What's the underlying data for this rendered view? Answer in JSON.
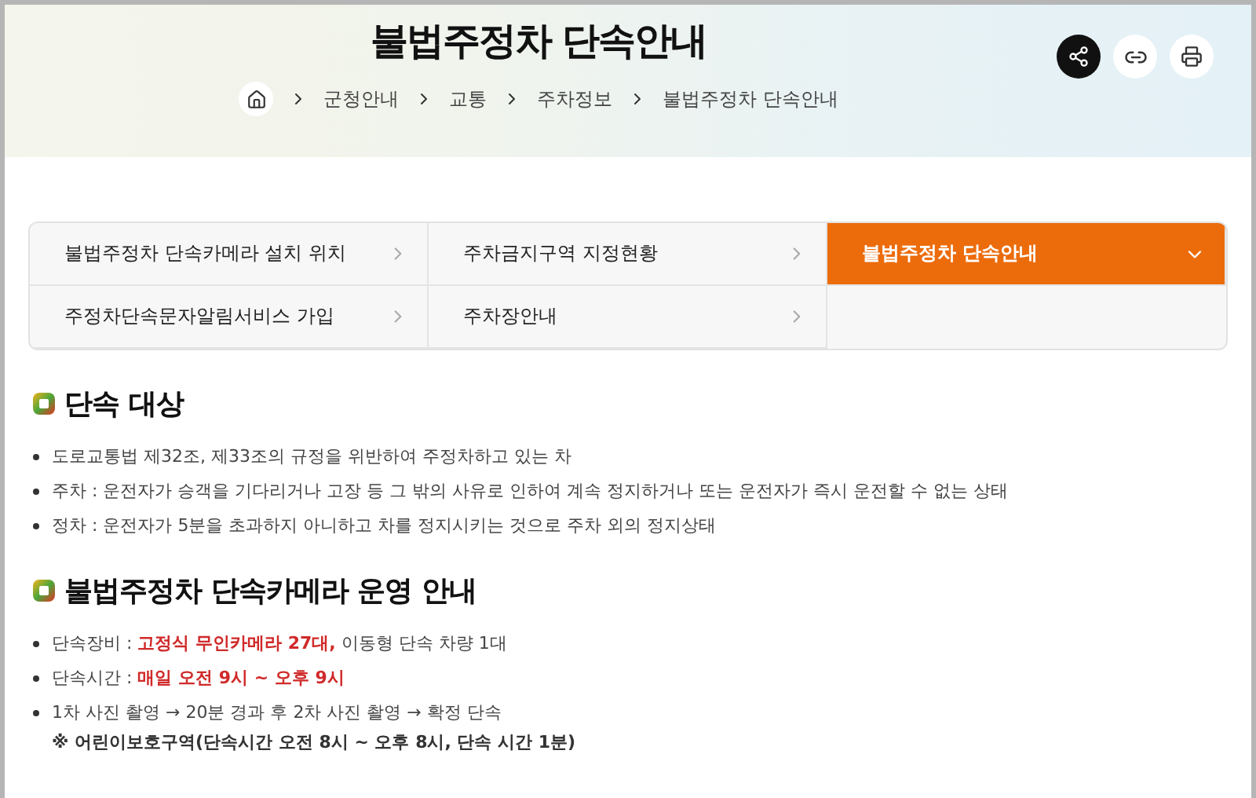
{
  "header": {
    "title": "불법주정차 단속안내",
    "breadcrumb": [
      "군청안내",
      "교통",
      "주차정보",
      "불법주정차 단속안내"
    ]
  },
  "tabs": [
    {
      "label": "불법주정차 단속카메라 설치 위치",
      "selected": false
    },
    {
      "label": "주차금지구역 지정현황",
      "selected": false
    },
    {
      "label": "불법주정차 단속안내",
      "selected": true
    },
    {
      "label": "주정차단속문자알림서비스 가입",
      "selected": false
    },
    {
      "label": "주차장안내",
      "selected": false
    }
  ],
  "sections": [
    {
      "heading": "단속 대상",
      "items": [
        {
          "text": "도로교통법 제32조, 제33조의 규정을 위반하여 주정차하고 있는 차"
        },
        {
          "text": "주차 : 운전자가 승객을 기다리거나 고장 등 그 밖의 사유로 인하여 계속 정지하거나 또는 운전자가 즉시 운전할 수 없는 상태"
        },
        {
          "text": "정차 : 운전자가 5분을 초과하지 아니하고 차를 정지시키는 것으로 주차 외의 정지상태"
        }
      ]
    },
    {
      "heading": "불법주정차 단속카메라 운영 안내",
      "items": [
        {
          "text": "단속장비 : **고정식 무인카메라 27대,** 이동형 단속 차량 1대"
        },
        {
          "text": "단속시간 : **매일 오전 9시 ~ 오후 9시**"
        },
        {
          "text": "1차 사진 촬영 → 20분 경과 후 2차 사진 촬영 → 확정 단속",
          "note": "※ 어린이보호구역(단속시간 오전 8시 ~ 오후 8시, 단속 시간 1분)"
        }
      ]
    }
  ]
}
